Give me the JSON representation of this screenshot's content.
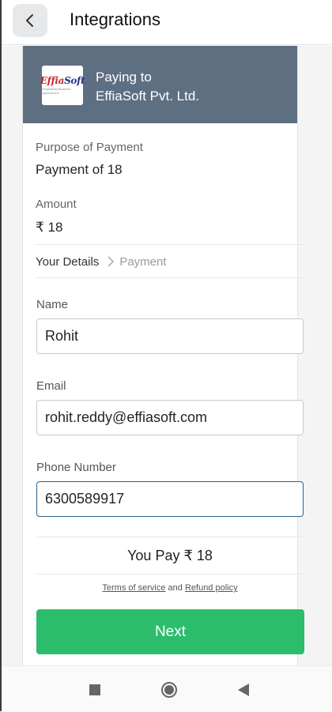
{
  "appbar": {
    "title": "Integrations",
    "back_icon": "chevron-left-icon"
  },
  "merchant": {
    "logo_text_red": "Effia",
    "logo_text_blue": "Soft",
    "logo_tagline": "Simplifying Business Applications",
    "paying_label": "Paying to",
    "merchant_name": "EffiaSoft Pvt. Ltd."
  },
  "payment": {
    "purpose_label": "Purpose of Payment",
    "purpose_value": "Payment of 18",
    "amount_label": "Amount",
    "amount_value": "₹ 18"
  },
  "steps": {
    "current": "Your Details",
    "next": "Payment"
  },
  "form": {
    "name_label": "Name",
    "name_value": "Rohit",
    "email_label": "Email",
    "email_value": "rohit.reddy@effiasoft.com",
    "phone_label": "Phone Number",
    "phone_value": "6300589917"
  },
  "summary": {
    "you_pay": "You Pay ₹ 18"
  },
  "legal": {
    "terms": "Terms of service",
    "and": "and",
    "refund": "Refund policy"
  },
  "next_label": "Next",
  "colors": {
    "header_bg": "#5f6f82",
    "button_green": "#2bbd6b",
    "focus_border": "#2b5f8a"
  },
  "system_nav": {
    "recents_icon": "square-icon",
    "home_icon": "circle-icon",
    "back_icon": "triangle-back-icon"
  }
}
